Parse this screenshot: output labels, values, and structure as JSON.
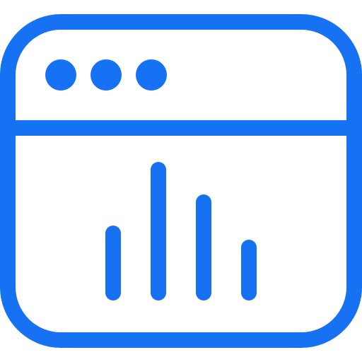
{
  "icon": {
    "name": "browser-analytics-icon",
    "accent_color": "#1672F3",
    "window_dots": 3,
    "bars": [
      {
        "level": 0.42
      },
      {
        "level": 0.87
      },
      {
        "level": 0.64
      },
      {
        "level": 0.32
      }
    ]
  }
}
